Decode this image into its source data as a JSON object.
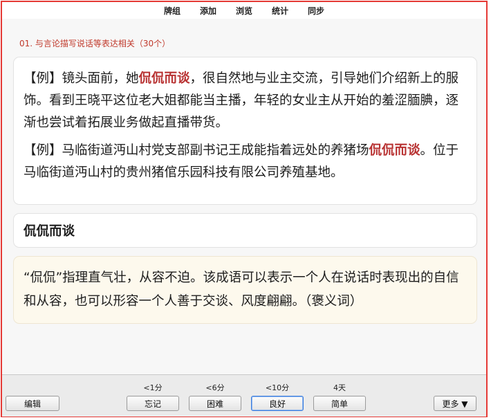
{
  "toolbar": {
    "items": [
      "牌组",
      "添加",
      "浏览",
      "统计",
      "同步"
    ]
  },
  "heading": "01. 与言论描写说话等表达相关（30个）",
  "examples": [
    {
      "prefix": "【例】镜头面前，她",
      "highlight": "侃侃而谈",
      "suffix": "，很自然地与业主交流，引导她们介绍新上的服饰。看到王晓平这位老大姐都能当主播，年轻的女业主从开始的羞涩腼腆，逐渐也尝试着拓展业务做起直播带货。"
    },
    {
      "prefix": "【例】马临街道沔山村党支部副书记王成能指着远处的养猪场",
      "highlight": "侃侃而谈",
      "suffix": "。位于马临街道沔山村的贵州猪倌乐园科技有限公司养殖基地。"
    }
  ],
  "word": "侃侃而谈",
  "definition": "“侃侃”指理直气壮，从容不迫。该成语可以表示一个人在说话时表现出的自信和从容，也可以形容一个人善于交谈、风度翩翩。（褒义词）",
  "bottom": {
    "edit_label": "编辑",
    "more_label": "更多 ▼",
    "answers": [
      {
        "interval": "<1分",
        "label": "忘记"
      },
      {
        "interval": "<6分",
        "label": "困难"
      },
      {
        "interval": "<10分",
        "label": "良好"
      },
      {
        "interval": "4天",
        "label": "简单"
      }
    ]
  },
  "colors": {
    "frame": "#e53935",
    "highlight": "#b83232",
    "heading": "#c0392b",
    "definition_bg": "#fdf9ed"
  }
}
